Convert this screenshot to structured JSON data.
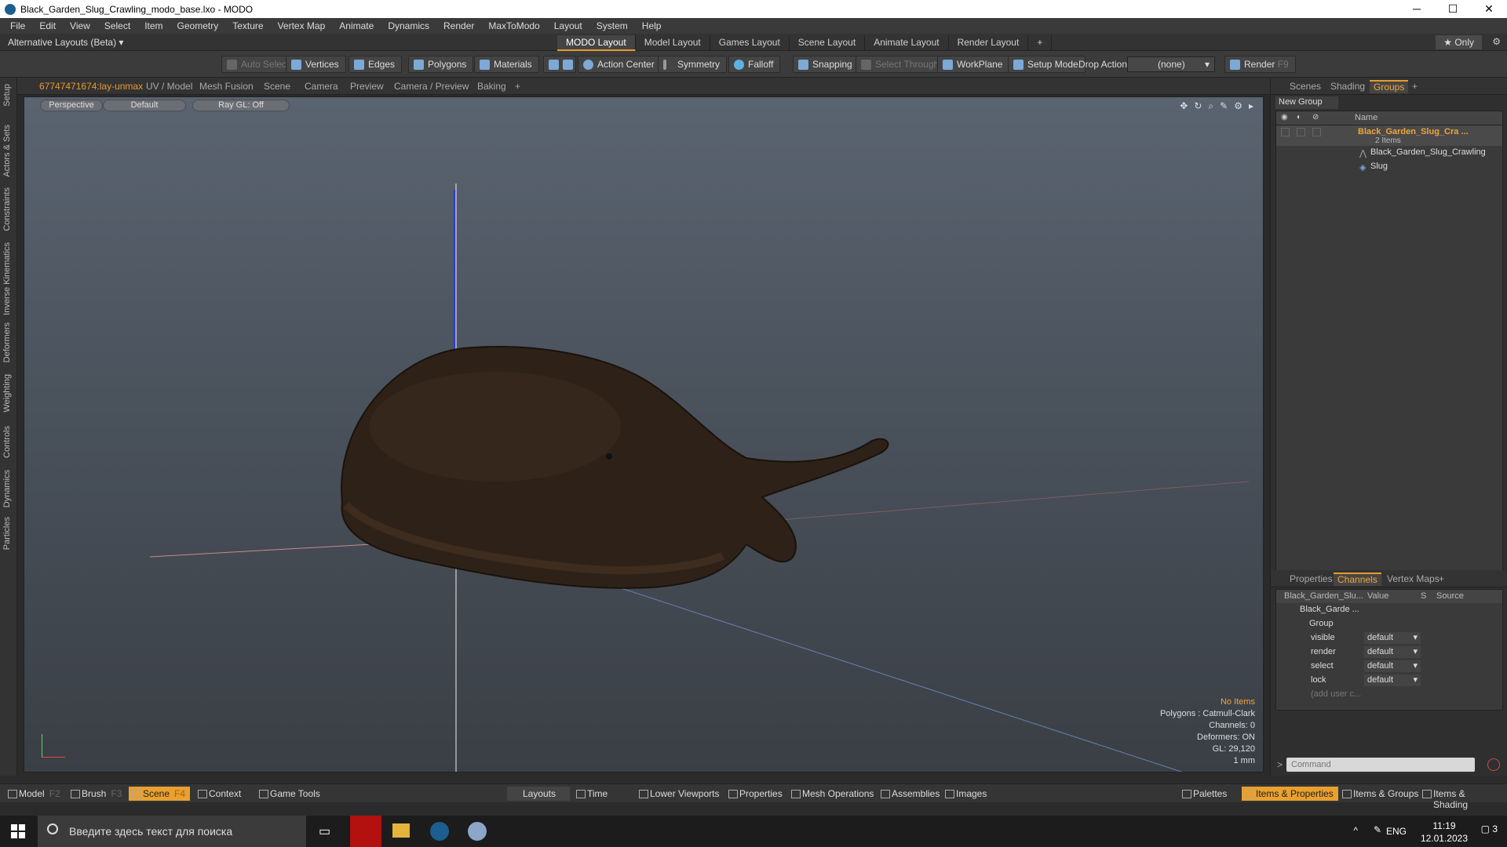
{
  "window": {
    "title": "Black_Garden_Slug_Crawling_modo_base.lxo - MODO",
    "controls": [
      "─",
      "☐",
      "✕"
    ]
  },
  "menu": [
    "File",
    "Edit",
    "View",
    "Select",
    "Item",
    "Geometry",
    "Texture",
    "Vertex Map",
    "Animate",
    "Dynamics",
    "Render",
    "MaxToModo",
    "Layout",
    "System",
    "Help"
  ],
  "layouts": {
    "alt": "Alternative Layouts (Beta) ▾",
    "tabs": [
      "MODO Layout",
      "Model Layout",
      "Games Layout",
      "Scene Layout",
      "Animate Layout",
      "Render Layout"
    ],
    "active_tab": 0,
    "add": "+",
    "only": "★  Only"
  },
  "toolbar": {
    "auto_select": "Auto Select",
    "vertices": "Vertices",
    "edges": "Edges",
    "polygons": "Polygons",
    "materials": "Materials",
    "action_center": "Action Center",
    "symmetry": "Symmetry",
    "falloff": "Falloff",
    "snapping": "Snapping",
    "select_through": "Select Through",
    "workplane": "WorkPlane",
    "setup_mode": "Setup Mode",
    "drop_action_label": "Drop Action",
    "drop_action_value": "(none)",
    "render": "Render",
    "render_key": "F9"
  },
  "left_tabs": [
    "Setup",
    "Actors & Sets",
    "Constraints",
    "Inverse Kinematics",
    "Deformers",
    "Weighting",
    "Controls",
    "Dynamics",
    "Particles"
  ],
  "viewport_tabs": [
    "67747471674:lay-unmax",
    "UV / Model",
    "Mesh Fusion",
    "Scene",
    "Camera",
    "Preview",
    "Camera / Preview",
    "Baking",
    "+"
  ],
  "viewport": {
    "view": "Perspective",
    "shading": "Default",
    "raygl": "Ray GL: Off",
    "stats": {
      "items": "No Items",
      "polygons": "Polygons : Catmull-Clark",
      "channels": "Channels: 0",
      "deformers": "Deformers: ON",
      "gl": "GL: 29,120",
      "unit": "1 mm"
    }
  },
  "right_tabs_top": [
    "Scenes",
    "Shading",
    "Groups",
    "+"
  ],
  "groups": {
    "new_group": "New Group",
    "name_header": "Name",
    "root": "Black_Garden_Slug_Cra ...",
    "count": "2 Items",
    "children": [
      "Black_Garden_Slug_Crawling",
      "Slug"
    ]
  },
  "right_tabs_bottom": [
    "Properties",
    "Channels",
    "Vertex Maps",
    "+"
  ],
  "channels": {
    "headers": [
      "Black_Garden_Slu...",
      "Value",
      "S",
      "Source"
    ],
    "root": "Black_Garde ...",
    "group": "Group",
    "rows": [
      {
        "name": "visible",
        "value": "default"
      },
      {
        "name": "render",
        "value": "default"
      },
      {
        "name": "select",
        "value": "default"
      },
      {
        "name": "lock",
        "value": "default"
      }
    ],
    "add_user": "(add user c..."
  },
  "command_placeholder": "Command",
  "bottom": {
    "model": "Model",
    "model_key": "F2",
    "brush": "Brush",
    "brush_key": "F3",
    "scene": "Scene",
    "scene_key": "F4",
    "context": "Context",
    "game_tools": "Game Tools",
    "layouts": "Layouts",
    "time": "Time",
    "lower_viewports": "Lower Viewports",
    "properties": "Properties",
    "mesh_operations": "Mesh Operations",
    "assemblies": "Assemblies",
    "images": "Images",
    "palettes": "Palettes",
    "items_properties": "Items & Properties",
    "items_groups": "Items & Groups",
    "items_shading": "Items & Shading"
  },
  "taskbar": {
    "search": "Введите здесь текст для поиска",
    "lang": "ENG",
    "time": "11:19",
    "date": "12.01.2023",
    "notif": "3"
  },
  "colors": {
    "accent": "#e89a2e",
    "viewport_top": "#5a6470",
    "slug": "#2e2218"
  }
}
